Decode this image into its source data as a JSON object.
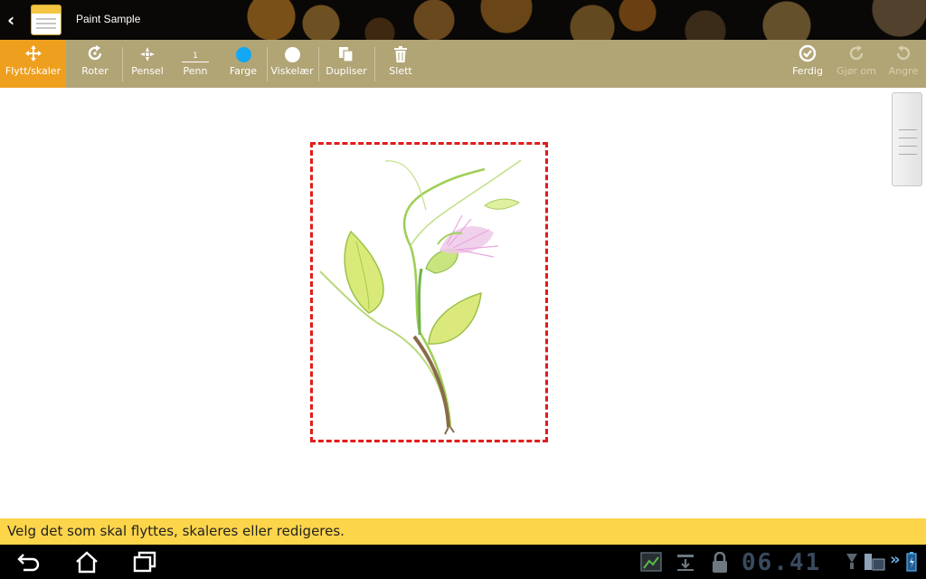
{
  "app": {
    "title": "Paint Sample",
    "back_icon": "chevron-left-icon",
    "app_icon": "notebook-icon"
  },
  "toolbar": {
    "tools": [
      {
        "label": "Flytt/skaler",
        "icon": "move-icon",
        "active": true
      },
      {
        "label": "Roter",
        "icon": "rotate-icon"
      },
      {
        "label": "Pensel",
        "icon": "brush-icon"
      },
      {
        "label": "Penn",
        "icon": "pen-size-icon",
        "pen_size": "1"
      },
      {
        "label": "Farge",
        "icon": "color-dot-icon",
        "color": "#13a8f3"
      },
      {
        "label": "Viskelær",
        "icon": "eraser-dot-icon"
      },
      {
        "label": "Dupliser",
        "icon": "duplicate-icon"
      },
      {
        "label": "Slett",
        "icon": "trash-icon"
      }
    ],
    "right": [
      {
        "label": "Ferdig",
        "icon": "check-circle-icon",
        "enabled": true
      },
      {
        "label": "Gjør om",
        "icon": "redo-icon",
        "enabled": false
      },
      {
        "label": "Angre",
        "icon": "undo-icon",
        "enabled": false
      }
    ]
  },
  "canvas": {
    "drawing": "flower-sketch",
    "selection_color": "#e01b1b"
  },
  "hint": {
    "text": "Velg det som skal flyttes, skaleres eller redigeres."
  },
  "system_bar": {
    "clock": "06.41",
    "nav": [
      "back-icon",
      "home-icon",
      "recent-apps-icon"
    ],
    "status_icons": [
      "screenshot-icon",
      "download-icon",
      "lock-icon",
      "wifi-icon",
      "keyboard-icon",
      "battery-icon"
    ]
  },
  "colors": {
    "toolbar_bg": "#b1a475",
    "active_tool": "#ef9f1e",
    "hint_bg": "#fcd54a"
  }
}
